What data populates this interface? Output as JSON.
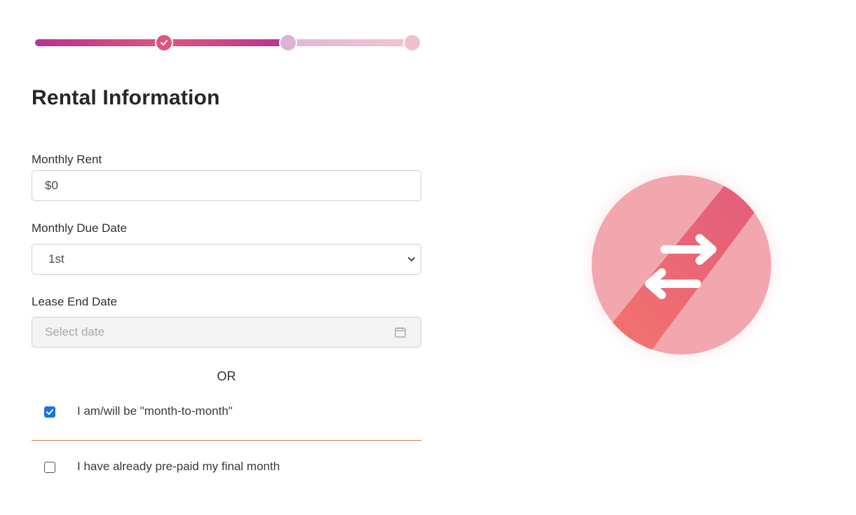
{
  "stepper": {
    "steps": [
      {
        "name": "step-1",
        "state": "completed"
      },
      {
        "name": "step-2",
        "state": "current"
      },
      {
        "name": "step-3",
        "state": "upcoming"
      }
    ],
    "colors": {
      "accent": "#e0557c",
      "accent_dark": "#b8328f",
      "pending": "#deb1d5"
    }
  },
  "page": {
    "title": "Rental Information"
  },
  "form": {
    "monthly_rent": {
      "label": "Monthly Rent",
      "value": "$0"
    },
    "due_date": {
      "label": "Monthly Due Date",
      "value": "1st"
    },
    "lease_end": {
      "label": "Lease End Date",
      "placeholder": "Select date",
      "icon": "calendar-icon"
    },
    "or_text": "OR",
    "month_to_month": {
      "label": "I am/will be \"month-to-month\"",
      "checked": true
    },
    "prepaid": {
      "label": "I have already pre-paid my final month",
      "checked": false
    }
  },
  "illustration": {
    "icon": "swap-arrows-icon",
    "colors": {
      "top": "#e05a7c",
      "bottom": "#f6766a"
    }
  }
}
